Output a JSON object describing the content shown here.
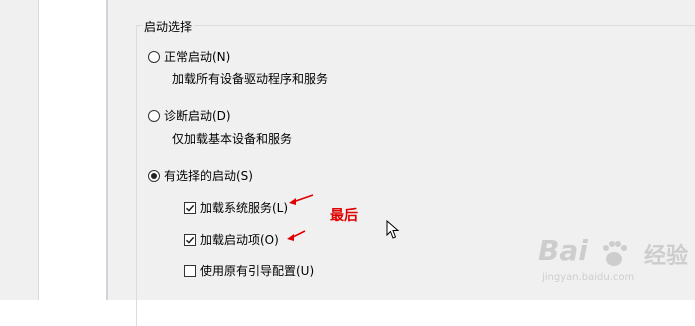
{
  "group": {
    "legend": "启动选择"
  },
  "options": {
    "normal": {
      "label": "正常启动(N)",
      "desc": "加载所有设备驱动程序和服务",
      "selected": false
    },
    "diagnostic": {
      "label": "诊断启动(D)",
      "desc": "仅加载基本设备和服务",
      "selected": false
    },
    "selective": {
      "label": "有选择的启动(S)",
      "selected": true
    }
  },
  "checks": {
    "load_system_services": {
      "label": "加载系统服务(L)",
      "checked": true
    },
    "load_startup_items": {
      "label": "加载启动项(O)",
      "checked": true
    },
    "use_original_boot": {
      "label": "使用原有引导配置(U)",
      "checked": false
    }
  },
  "annotation": {
    "text": "最后",
    "color": "#e00000"
  },
  "watermark": {
    "main": "Bai",
    "cn": "经验",
    "url": "jingyan.baidu.com"
  }
}
